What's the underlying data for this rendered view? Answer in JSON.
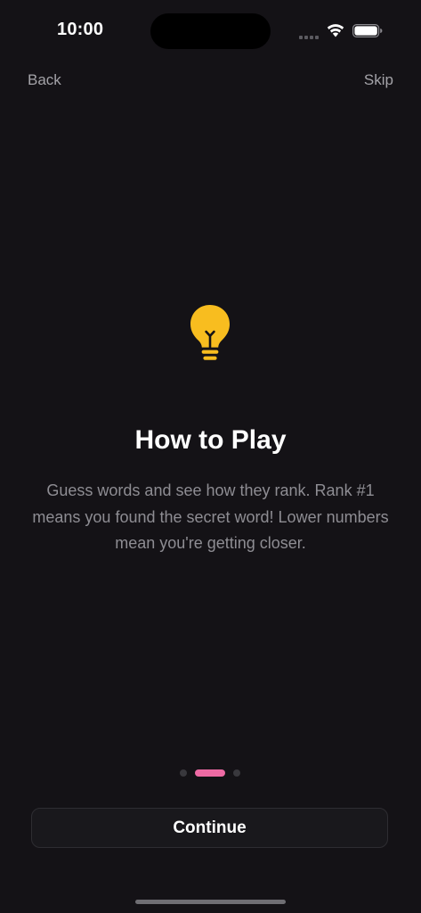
{
  "status_bar": {
    "time": "10:00"
  },
  "nav": {
    "back_label": "Back",
    "skip_label": "Skip"
  },
  "content": {
    "icon": "lightbulb-icon",
    "title": "How to Play",
    "body": "Guess words and see how they rank. Rank #1 means you found the secret word! Lower numbers mean you're getting closer."
  },
  "pager": {
    "total_pages": 3,
    "current_page": 2
  },
  "actions": {
    "continue_label": "Continue"
  },
  "colors": {
    "background": "#141216",
    "accent": "#ee6aa4",
    "bulb": "#f8bd1f",
    "muted_text": "#8e8d93"
  }
}
